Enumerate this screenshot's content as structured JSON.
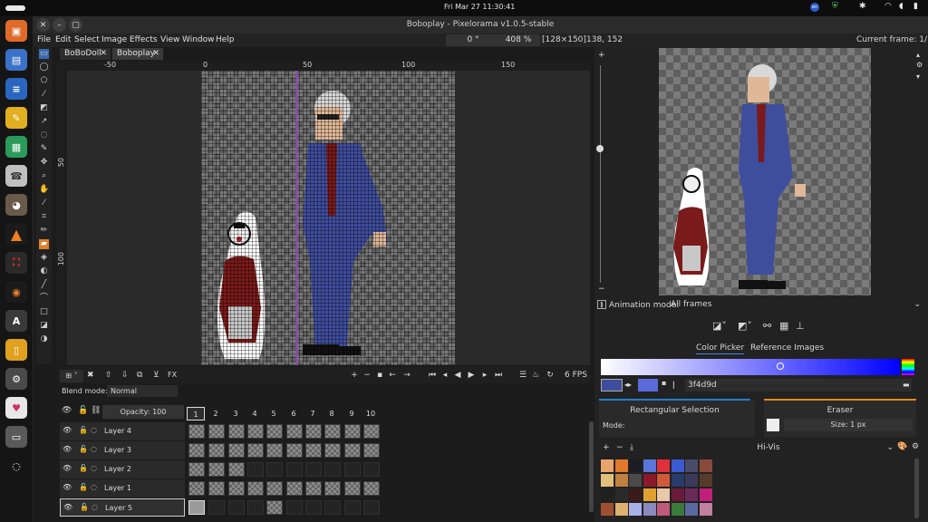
{
  "system": {
    "clock": "Fri Mar 27  11:30:41",
    "ime_badge": "en"
  },
  "window": {
    "title": "Boboplay - Pixelorama v1.0.5-stable"
  },
  "menu": [
    "File",
    "Edit",
    "Select",
    "Image",
    "Effects",
    "View",
    "Window",
    "Help"
  ],
  "toolbar": {
    "rotation": "0 °",
    "zoom": "408 %",
    "canvas_size": "[128×150]",
    "cursor_pos": "138, 152",
    "current_frame": "Current frame: 1/10"
  },
  "tabs": [
    {
      "label": "BoBoDoll"
    },
    {
      "label": "Boboplay"
    }
  ],
  "rulers": {
    "h": [
      "-50",
      "0",
      "50",
      "100",
      "150"
    ],
    "v": [
      "50",
      "100"
    ]
  },
  "playback": {
    "fps": "6 FPS"
  },
  "timeline": {
    "blend_mode_label": "Blend mode:",
    "blend_mode_value": "Normal",
    "opacity": "Opacity: 100",
    "fx": "FX",
    "frames": [
      "1",
      "2",
      "3",
      "4",
      "5",
      "6",
      "7",
      "8",
      "9",
      "10"
    ],
    "layers": [
      {
        "name": "Layer 4",
        "cels": [
          1,
          1,
          1,
          1,
          1,
          1,
          1,
          1,
          1,
          1
        ]
      },
      {
        "name": "Layer 3",
        "cels": [
          1,
          1,
          1,
          1,
          1,
          1,
          1,
          1,
          1,
          1
        ]
      },
      {
        "name": "Layer 2",
        "cels": [
          1,
          1,
          1,
          0,
          0,
          0,
          0,
          0,
          0,
          0
        ]
      },
      {
        "name": "Layer 1",
        "cels": [
          1,
          1,
          1,
          1,
          1,
          1,
          1,
          1,
          1,
          1
        ]
      },
      {
        "name": "Layer 5",
        "cels": [
          1,
          0,
          0,
          0,
          1,
          0,
          0,
          0,
          0,
          0
        ]
      }
    ]
  },
  "animation": {
    "label": "Animation mode:",
    "value": "All frames"
  },
  "panel_tabs": {
    "color_picker": "Color Picker",
    "reference": "Reference Images"
  },
  "color": {
    "hex": "3f4d9d",
    "left_swatch": "#3f4d9d",
    "right_swatch": "#5a6bdc"
  },
  "tools_panel": {
    "left": {
      "title": "Rectangular Selection",
      "mode": "Mode:",
      "accent": "#1f7ed0"
    },
    "right": {
      "title": "Eraser",
      "size": "Size: 1 px",
      "accent": "#e08a1e"
    }
  },
  "palette": {
    "name": "Hi-Vis",
    "colors": [
      "#e8a46a",
      "#e07a2a",
      "#1c1c24",
      "#5a76d8",
      "#e0303a",
      "#3a5ad0",
      "#4a4a6a",
      "#8a4a3a",
      "#e0c07a",
      "#c08040",
      "#4a4a4a",
      "#8a1a2a",
      "#d05a3a",
      "#2a3a6a",
      "#3a3a5a",
      "#5a3a2a",
      "#202020",
      "#2a2a2a",
      "#3a1a1a",
      "#e0a030",
      "#e8c8a8",
      "#6a1a3a",
      "#6a2a5a",
      "#c0207a",
      "#a05030",
      "#e0b070",
      "#a8b0e8",
      "#8a8ac0",
      "#c05a7a",
      "#3a7a3a",
      "#5a6aa0",
      "#c080a0"
    ]
  }
}
